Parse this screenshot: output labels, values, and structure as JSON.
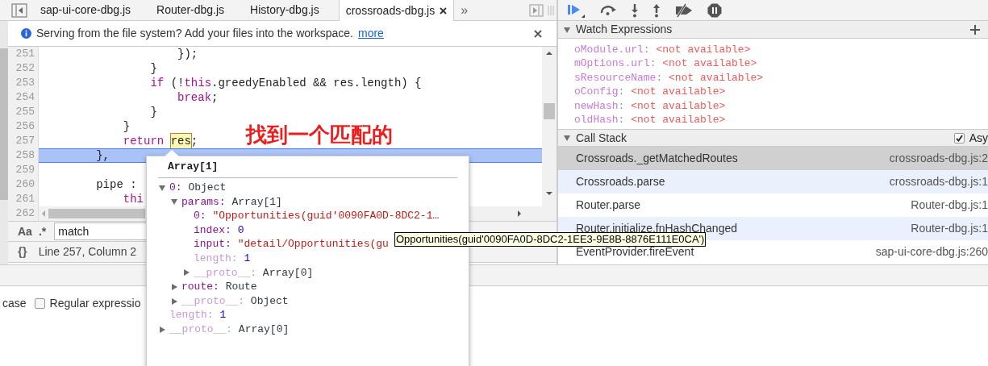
{
  "tabs": [
    {
      "label": "sap-ui-core-dbg.js",
      "selected": false
    },
    {
      "label": "Router-dbg.js",
      "selected": false
    },
    {
      "label": "History-dbg.js",
      "selected": false
    },
    {
      "label": "crossroads-dbg.js",
      "selected": true
    }
  ],
  "tab_overflow": "»",
  "infobar": {
    "text": "Serving from the file system? Add your files into the workspace.",
    "link": "more"
  },
  "code_lines": [
    {
      "number": "251",
      "highlighted": false,
      "segments": [
        {
          "text": "                    });",
          "kind": "plain"
        }
      ]
    },
    {
      "number": "252",
      "highlighted": false,
      "segments": [
        {
          "text": "                }",
          "kind": "plain"
        }
      ]
    },
    {
      "number": "253",
      "highlighted": false,
      "segments": [
        {
          "text": "                if",
          "kind": "keyword"
        },
        {
          "text": " (!",
          "kind": "plain"
        },
        {
          "text": "this",
          "kind": "keyword"
        },
        {
          "text": ".greedyEnabled && res.length) {",
          "kind": "plain"
        }
      ]
    },
    {
      "number": "254",
      "highlighted": false,
      "segments": [
        {
          "text": "                    break",
          "kind": "keyword"
        },
        {
          "text": ";",
          "kind": "plain"
        }
      ]
    },
    {
      "number": "255",
      "highlighted": false,
      "segments": [
        {
          "text": "                }",
          "kind": "plain"
        }
      ]
    },
    {
      "number": "256",
      "highlighted": false,
      "segments": [
        {
          "text": "            }",
          "kind": "plain"
        }
      ]
    },
    {
      "number": "257",
      "highlighted": false,
      "segments": [
        {
          "text": "            return ",
          "kind": "keyword"
        },
        {
          "text": "res",
          "kind": "match"
        },
        {
          "text": ";",
          "kind": "plain"
        }
      ]
    },
    {
      "number": "258",
      "highlighted": true,
      "segments": [
        {
          "text": "        },",
          "kind": "plain"
        }
      ]
    },
    {
      "number": "259",
      "highlighted": false
    },
    {
      "number": "260",
      "highlighted": false,
      "segments": [
        {
          "text": "        pipe :",
          "kind": "plain"
        }
      ]
    },
    {
      "number": "261",
      "highlighted": false,
      "segments": [
        {
          "text": "            thi",
          "kind": "keyword"
        }
      ]
    },
    {
      "number": "262",
      "highlighted": false
    }
  ],
  "search": {
    "case_toggle": "Aa",
    "regex_toggle": ".*",
    "value": "match"
  },
  "status": {
    "format_toggle": "{}",
    "position": "Line 257, Column 2"
  },
  "annotation": "找到一个匹配的",
  "popover": {
    "title": "Array[1]",
    "items": [
      {
        "name": "0:",
        "value": "Object",
        "kind": "object",
        "expanded": true,
        "dimmed": false,
        "children": [
          {
            "name": "params:",
            "value": "Array[1]",
            "kind": "object",
            "expanded": true,
            "dimmed": false,
            "children": [
              {
                "name": "0:",
                "value": "\"Opportunities(guid'0090FA0D-8DC2-1…",
                "kind": "string",
                "dimmed": false
              },
              {
                "name": "index:",
                "value": "0",
                "kind": "number",
                "dimmed": false
              },
              {
                "name": "input:",
                "value": "\"detail/Opportunities(gu",
                "kind": "string",
                "dimmed": false
              },
              {
                "name": "length:",
                "value": "1",
                "kind": "number",
                "dimmed": true
              },
              {
                "name": "__proto__:",
                "value": "Array[0]",
                "kind": "object",
                "expanded": false,
                "dimmed": true
              }
            ]
          },
          {
            "name": "route:",
            "value": "Route",
            "kind": "object",
            "expanded": false,
            "dimmed": false
          },
          {
            "name": "__proto__:",
            "value": "Object",
            "kind": "object",
            "expanded": false,
            "dimmed": true
          }
        ]
      },
      {
        "name": "length:",
        "value": "1",
        "kind": "number",
        "dimmed": true
      },
      {
        "name": "__proto__:",
        "value": "Array[0]",
        "kind": "object",
        "expanded": false,
        "dimmed": true
      }
    ]
  },
  "tooltip": "Opportunities(guid'0090FA0D-8DC2-1EE3-9E8B-8876E111E0CA')",
  "watch": {
    "title": "Watch Expressions",
    "expanded": true,
    "items": [
      {
        "name": "oModule.url:",
        "value": "<not available>"
      },
      {
        "name": "mOptions.url:",
        "value": "<not available>"
      },
      {
        "name": "sResourceName:",
        "value": "<not available>"
      },
      {
        "name": "oConfig:",
        "value": "<not available>"
      },
      {
        "name": "newHash:",
        "value": "<not available>"
      },
      {
        "name": "oldHash:",
        "value": "<not available>"
      }
    ]
  },
  "call_stack": {
    "title": "Call Stack",
    "expanded": true,
    "async": {
      "label": "Asy",
      "checked": true
    },
    "frames": [
      {
        "function": "Crossroads._getMatchedRoutes",
        "location": "crossroads-dbg.js:2",
        "selected": true
      },
      {
        "function": "Crossroads.parse",
        "location": "crossroads-dbg.js:1",
        "selected": false
      },
      {
        "function": "Router.parse",
        "location": "Router-dbg.js:1",
        "selected": false
      },
      {
        "function": "Router.initialize.fnHashChanged",
        "location": "Router-dbg.js:1",
        "selected": false
      },
      {
        "function": "EventProvider.fireEvent",
        "location": "sap-ui-core-dbg.js:260",
        "selected": false
      }
    ]
  },
  "drawer": {
    "options": [
      {
        "label": "case",
        "kind": "text"
      },
      {
        "label": "Regular expressio",
        "kind": "checkbox",
        "checked": false
      }
    ]
  }
}
